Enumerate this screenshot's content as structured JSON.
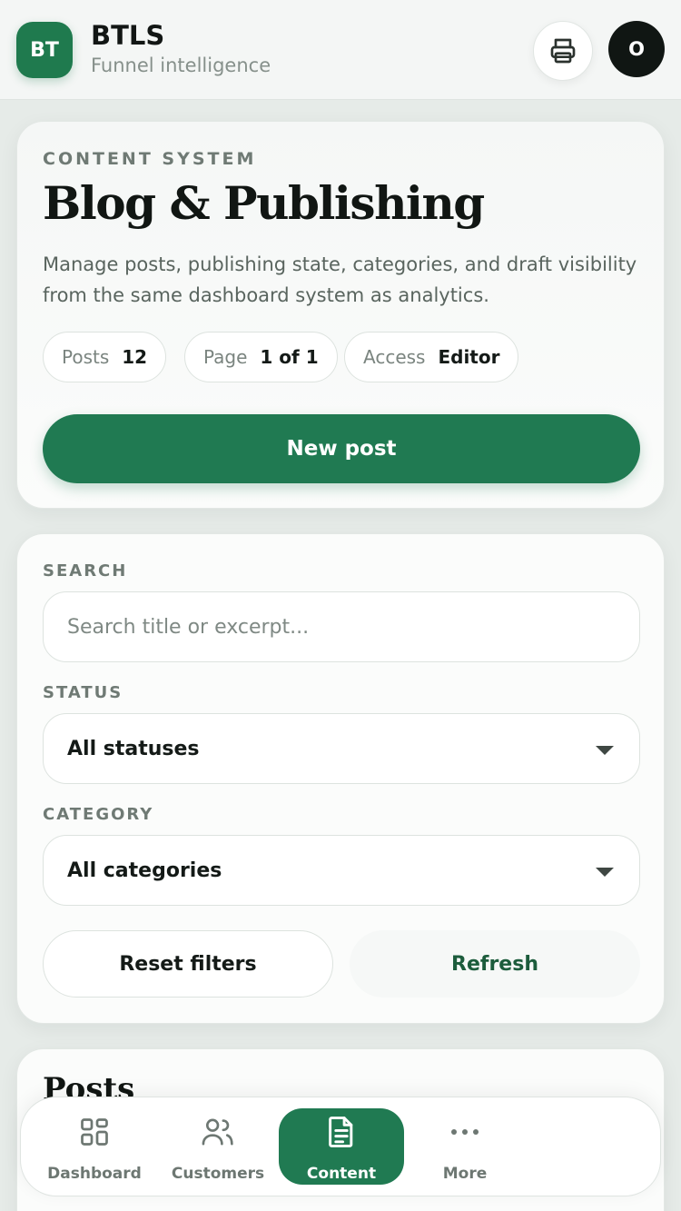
{
  "header": {
    "logo_text": "BT",
    "brand_name": "BTLS",
    "brand_subtitle": "Funnel intelligence",
    "print_icon": "printer-icon",
    "avatar_initial": "O"
  },
  "hero": {
    "eyebrow": "CONTENT SYSTEM",
    "title": "Blog & Publishing",
    "description": "Manage posts, publishing state, categories, and draft visibility from the same dashboard system as analytics.",
    "chips": [
      {
        "label": "Posts",
        "value": "12"
      },
      {
        "label": "Page",
        "value": "1 of 1"
      },
      {
        "label": "Access",
        "value": "Editor"
      }
    ],
    "primary_button": "New post"
  },
  "filters": {
    "search_label": "SEARCH",
    "search_placeholder": "Search title or excerpt...",
    "search_value": "",
    "status_label": "STATUS",
    "status_value": "All statuses",
    "category_label": "CATEGORY",
    "category_value": "All categories",
    "reset_button": "Reset filters",
    "refresh_button": "Refresh"
  },
  "posts": {
    "title": "Posts"
  },
  "nav": {
    "items": [
      {
        "label": "Dashboard",
        "icon": "grid-icon",
        "active": false
      },
      {
        "label": "Customers",
        "icon": "users-icon",
        "active": false
      },
      {
        "label": "Content",
        "icon": "document-icon",
        "active": true
      },
      {
        "label": "More",
        "icon": "more-dots-icon",
        "active": false
      }
    ]
  },
  "colors": {
    "accent": "#207a52",
    "avatar_bg": "#101613",
    "background": "#e6ebe8"
  }
}
